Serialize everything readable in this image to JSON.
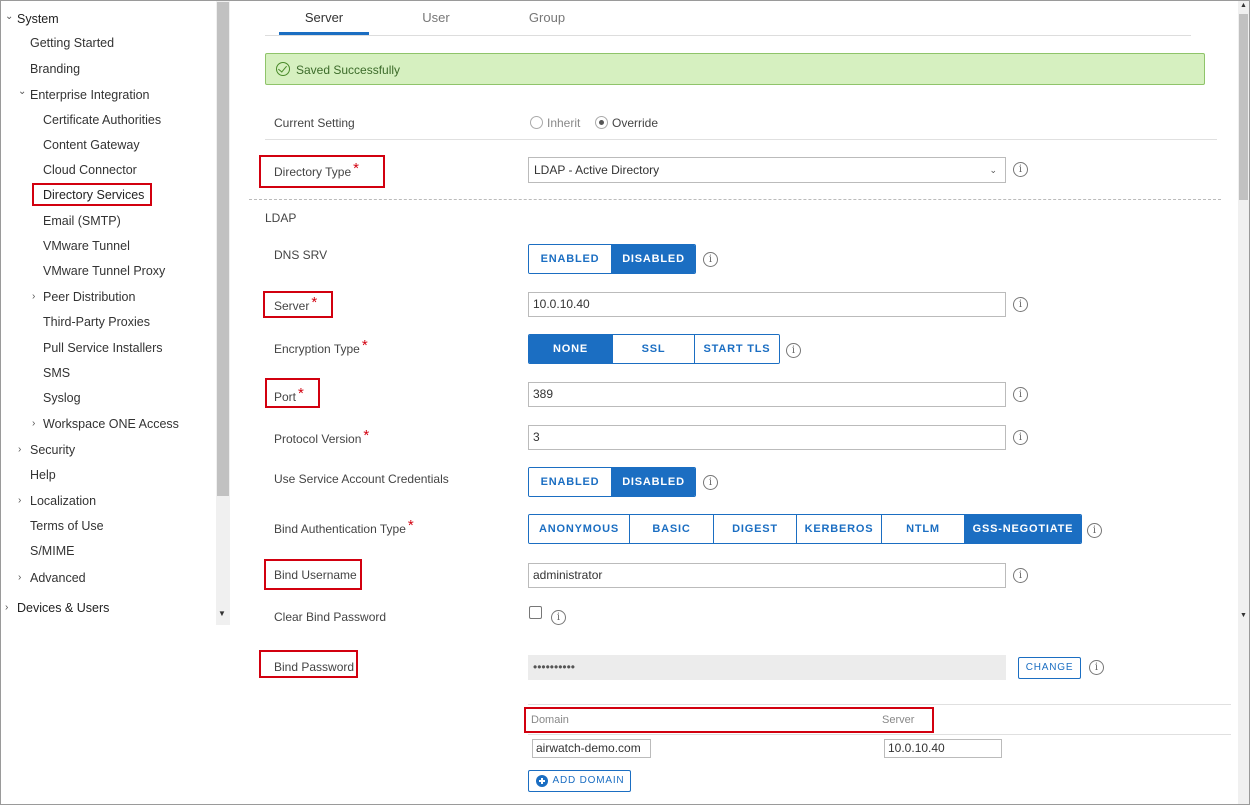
{
  "sidebar": {
    "system": "System",
    "getting_started": "Getting Started",
    "branding": "Branding",
    "enterprise_integration": "Enterprise Integration",
    "certificate_authorities": "Certificate Authorities",
    "content_gateway": "Content Gateway",
    "cloud_connector": "Cloud Connector",
    "directory_services": "Directory Services",
    "email_smtp": "Email (SMTP)",
    "vmware_tunnel": "VMware Tunnel",
    "vmware_tunnel_proxy": "VMware Tunnel Proxy",
    "peer_distribution": "Peer Distribution",
    "third_party_proxies": "Third-Party Proxies",
    "pull_service_installers": "Pull Service Installers",
    "sms": "SMS",
    "syslog": "Syslog",
    "workspace_one_access": "Workspace ONE Access",
    "security": "Security",
    "help": "Help",
    "localization": "Localization",
    "terms_of_use": "Terms of Use",
    "smime": "S/MIME",
    "advanced": "Advanced",
    "devices_users": "Devices & Users"
  },
  "tabs": {
    "server": "Server",
    "user": "User",
    "group": "Group"
  },
  "alert": {
    "text": "Saved Successfully"
  },
  "form": {
    "current_setting": {
      "label": "Current Setting",
      "inherit": "Inherit",
      "override": "Override",
      "selected": "Override"
    },
    "directory_type": {
      "label": "Directory Type",
      "value": "LDAP - Active Directory"
    },
    "section_ldap": "LDAP",
    "dns_srv": {
      "label": "DNS SRV",
      "enabled": "ENABLED",
      "disabled": "DISABLED",
      "selected": "DISABLED"
    },
    "server": {
      "label": "Server",
      "value": "10.0.10.40"
    },
    "encryption_type": {
      "label": "Encryption Type",
      "none": "NONE",
      "ssl": "SSL",
      "start_tls": "START TLS",
      "selected": "NONE"
    },
    "port": {
      "label": "Port",
      "value": "389"
    },
    "protocol_version": {
      "label": "Protocol Version",
      "value": "3"
    },
    "service_account": {
      "label": "Use Service Account Credentials",
      "enabled": "ENABLED",
      "disabled": "DISABLED",
      "selected": "DISABLED"
    },
    "bind_auth_type": {
      "label": "Bind Authentication Type",
      "anonymous": "ANONYMOUS",
      "basic": "BASIC",
      "digest": "DIGEST",
      "kerberos": "KERBEROS",
      "ntlm": "NTLM",
      "gss": "GSS-NEGOTIATE",
      "selected": "GSS-NEGOTIATE"
    },
    "bind_username": {
      "label": "Bind Username",
      "value": "administrator"
    },
    "clear_bind_password": {
      "label": "Clear Bind Password"
    },
    "bind_password": {
      "label": "Bind Password",
      "value": "••••••••••",
      "change": "CHANGE"
    },
    "domains": {
      "col_domain": "Domain",
      "col_server": "Server",
      "rows": [
        {
          "domain": "airwatch-demo.com",
          "server": "10.0.10.40"
        }
      ],
      "add": "ADD DOMAIN"
    }
  },
  "colors": {
    "accent": "#1b6ec2",
    "highlight": "#d2000f",
    "success_bg": "#d6f0c0"
  }
}
